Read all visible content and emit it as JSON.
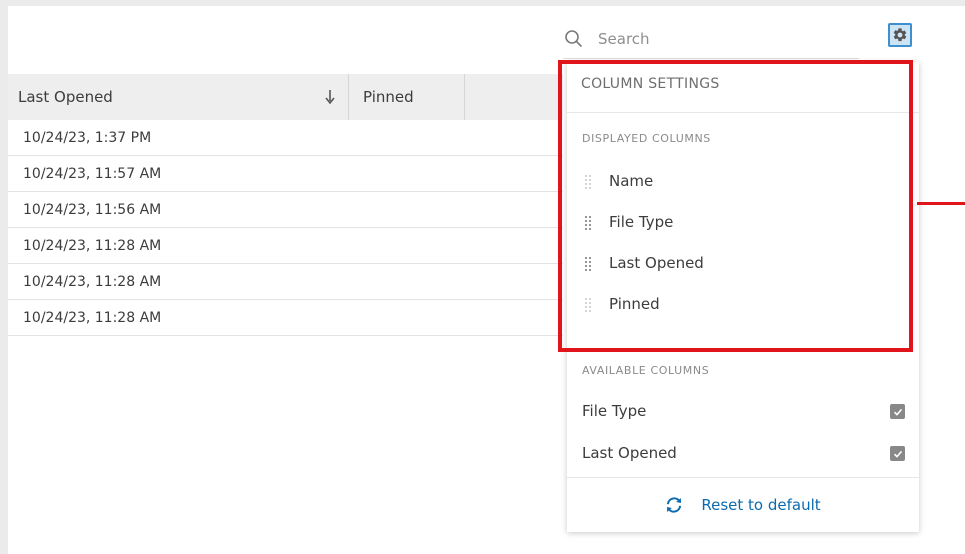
{
  "search": {
    "placeholder": "Search",
    "value": ""
  },
  "table": {
    "columns": [
      {
        "label": "Last Opened",
        "sort": "descending"
      },
      {
        "label": "Pinned"
      }
    ],
    "rows": [
      {
        "last_opened": "10/24/23, 1:37 PM"
      },
      {
        "last_opened": "10/24/23, 11:57 AM"
      },
      {
        "last_opened": "10/24/23, 11:56 AM"
      },
      {
        "last_opened": "10/24/23, 11:28 AM"
      },
      {
        "last_opened": "10/24/23, 11:28 AM"
      },
      {
        "last_opened": "10/24/23, 11:28 AM"
      }
    ]
  },
  "column_settings": {
    "title": "COLUMN SETTINGS",
    "displayed_label": "DISPLAYED COLUMNS",
    "displayed": [
      "Name",
      "File Type",
      "Last Opened",
      "Pinned"
    ],
    "available_label": "AVAILABLE COLUMNS",
    "available": [
      {
        "label": "File Type",
        "checked": true
      },
      {
        "label": "Last Opened",
        "checked": true
      }
    ],
    "reset_label": "Reset to default"
  },
  "icons": {
    "search": "search-icon",
    "settings": "gear-icon",
    "sort": "arrow-down-icon",
    "drag": "drag-handle-icon",
    "check": "check-icon",
    "reset": "refresh-icon"
  },
  "colors": {
    "accent": "#0c6ab0",
    "highlight": "#e2141b",
    "gear_button_bg": "#cde4f4",
    "gear_button_border": "#3d8fd0",
    "header_bg": "#eeeeee",
    "checkbox": "#888888"
  }
}
